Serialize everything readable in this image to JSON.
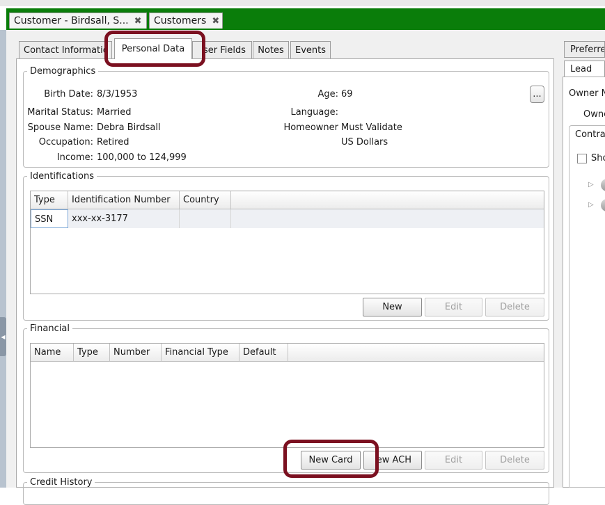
{
  "doc_tabs": [
    {
      "label": "Customer - Birdsall, S..."
    },
    {
      "label": "Customers"
    }
  ],
  "sub_tabs": [
    {
      "label": "Contact Informatio"
    },
    {
      "label": "Personal Data"
    },
    {
      "label": "ser Fields"
    },
    {
      "label": "Notes"
    },
    {
      "label": "Events"
    }
  ],
  "demographics": {
    "title": "Demographics",
    "birth_date_label": "Birth Date:",
    "birth_date": "8/3/1953",
    "age_label": "Age:",
    "age": "69",
    "marital_label": "Marital Status:",
    "marital": "Married",
    "language_label": "Language:",
    "language": "",
    "spouse_label": "Spouse Name:",
    "spouse": "Debra Birdsall",
    "homeowner_label": "Homeowner",
    "homeowner": "Must Validate",
    "occupation_label": "Occupation:",
    "occupation": "Retired",
    "currency": "US Dollars",
    "income_label": "Income:",
    "income": "100,000 to 124,999",
    "more_button": "..."
  },
  "identifications": {
    "title": "Identifications",
    "columns": [
      "Type",
      "Identification Number",
      "Country"
    ],
    "rows": [
      {
        "type": "SSN",
        "number": "xxx-xx-3177",
        "country": ""
      }
    ],
    "buttons": {
      "new": "New",
      "edit": "Edit",
      "delete": "Delete"
    }
  },
  "financial": {
    "title": "Financial",
    "columns": [
      "Name",
      "Type",
      "Number",
      "Financial Type",
      "Default"
    ],
    "buttons": {
      "new_card": "New Card",
      "new_ach": "ew ACH",
      "edit": "Edit",
      "delete": "Delete"
    }
  },
  "credit_history": {
    "title": "Credit History"
  },
  "right_panel": {
    "tabs": [
      "Preferre",
      "Lead"
    ],
    "owner_n": "Owner N",
    "owne": "Owne",
    "contrac": "Contrac",
    "sho": "Sho"
  },
  "colors": {
    "doc_bar": "#0a7d0a",
    "highlight": "#7b1020"
  }
}
